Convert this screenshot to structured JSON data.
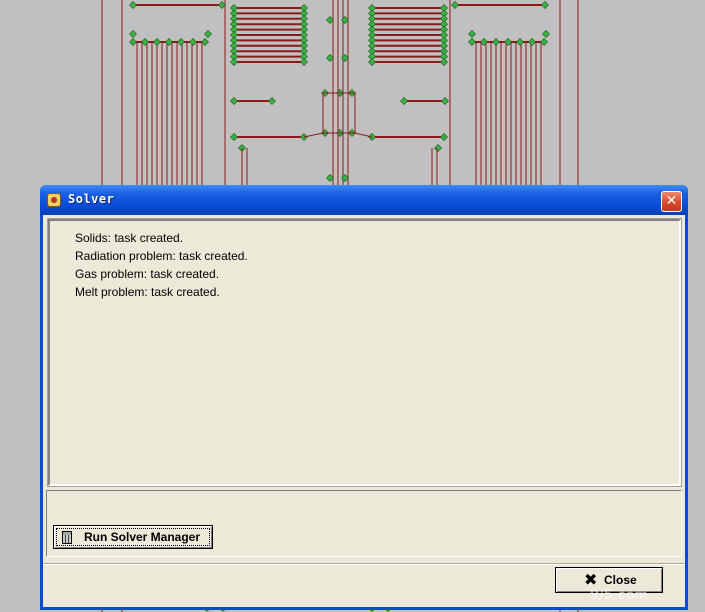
{
  "window": {
    "title": "Solver",
    "close_glyph": "✕"
  },
  "log": {
    "lines": [
      "Solids: task created.",
      "Radiation problem: task created.",
      "Gas problem: task created.",
      "Melt problem: task created."
    ]
  },
  "buttons": {
    "run_solver_manager": "Run Solver Manager",
    "close": "Close",
    "close_glyph": "✖"
  },
  "watermark": "9/5·com",
  "icons": {
    "app": "solver-app-icon",
    "run": "calculator-icon",
    "close": "x-icon"
  },
  "colors": {
    "background": "#c0c0c0",
    "mesh_line": "#8b1a1a",
    "mesh_node": "#3cb043",
    "titlebar": "#0a4bd6",
    "client": "#ece9d8"
  }
}
